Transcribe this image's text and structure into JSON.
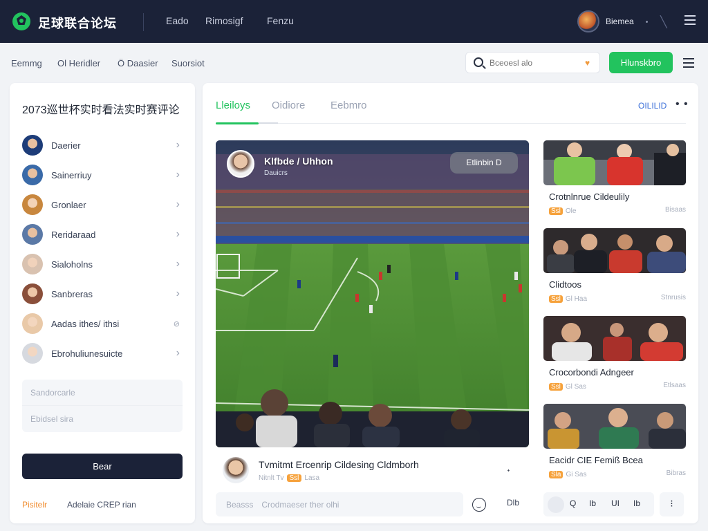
{
  "app": {
    "brand": "足球联合论坛"
  },
  "topbar": {
    "nav": [
      "Eado",
      "Rimosigf",
      "Fenzu"
    ],
    "username": "Biemea",
    "slash_glyph": "╲"
  },
  "subnav": {
    "items": [
      "Eemmg",
      "Ol Heridler",
      "Ö Daasier",
      "Suorsiot"
    ],
    "search_placeholder": "Bceoesl alo",
    "action_button": "Hlunskbro"
  },
  "left_panel": {
    "title": "2073巡世杯实时看法实时赛评论",
    "users": [
      {
        "name": "Daerier",
        "color": "#1d3c78"
      },
      {
        "name": "Sainerriuy",
        "color": "#3a6aa8"
      },
      {
        "name": "Gronlaer",
        "color": "#c8873e"
      },
      {
        "name": "Reridaraad",
        "color": "#5b79a6"
      },
      {
        "name": "Sialoholns",
        "color": "#d9c2b0"
      },
      {
        "name": "Sanbreras",
        "color": "#8a4f3a"
      },
      {
        "name": "Aadas ithes/ ithsi",
        "color": "#e9c9a8"
      },
      {
        "name": "Ebrohuliunesuicte",
        "color": "#d6d9df"
      }
    ],
    "input_top_placeholder": "Sandorcarle",
    "input_bottom_placeholder": "Ebidsel sira",
    "submit_button": "Bear",
    "footer_link": "Pisitelr",
    "footer_text": "Adelaie CREP rian"
  },
  "main": {
    "tabs": [
      "Lleiloys",
      "Oidiore",
      "Eebmro"
    ],
    "tab_action": "OILILID",
    "more_glyph": "• •",
    "stream": {
      "title": "Klfbde / Uhhon",
      "subtitle": "Dauicrs",
      "pill": "Etlinbin D"
    },
    "caption": {
      "title": "Tvmitmt Ercenrip Cildesing Cldmborh",
      "meta_left": "Nitnlt Tv",
      "meta_tag": "Ssl",
      "meta_right": "Lasa",
      "arrow": "ᐩ"
    },
    "comment_placeholder_1": "Beasss",
    "comment_placeholder_2": "Crodmaeser ther olhi",
    "gift_label": "Dlb"
  },
  "cards": [
    {
      "title": "Crotnlnrue Cildeulily",
      "tag": "Ssl",
      "meta": "Ole",
      "time": "Bisaas"
    },
    {
      "title": "Clidtoos",
      "tag": "Ssl",
      "meta": "Gl Haa",
      "time": "Stnrusis"
    },
    {
      "title": "Crocorbondi Adngeer",
      "tag": "Ssl",
      "meta": "Gl Sas",
      "time": "Etlsaas"
    },
    {
      "title": "Eacidr CIE Femiß Bcea",
      "tag": "Sla",
      "meta": "Gi Sas",
      "time": "Bibras"
    }
  ],
  "toolbar": {
    "items": [
      "Q",
      "Ib",
      "UI",
      "Ib"
    ],
    "more": "⁝"
  },
  "colors": {
    "accent": "#22c35e",
    "dark": "#1b2238",
    "warm": "#f6a23c"
  }
}
